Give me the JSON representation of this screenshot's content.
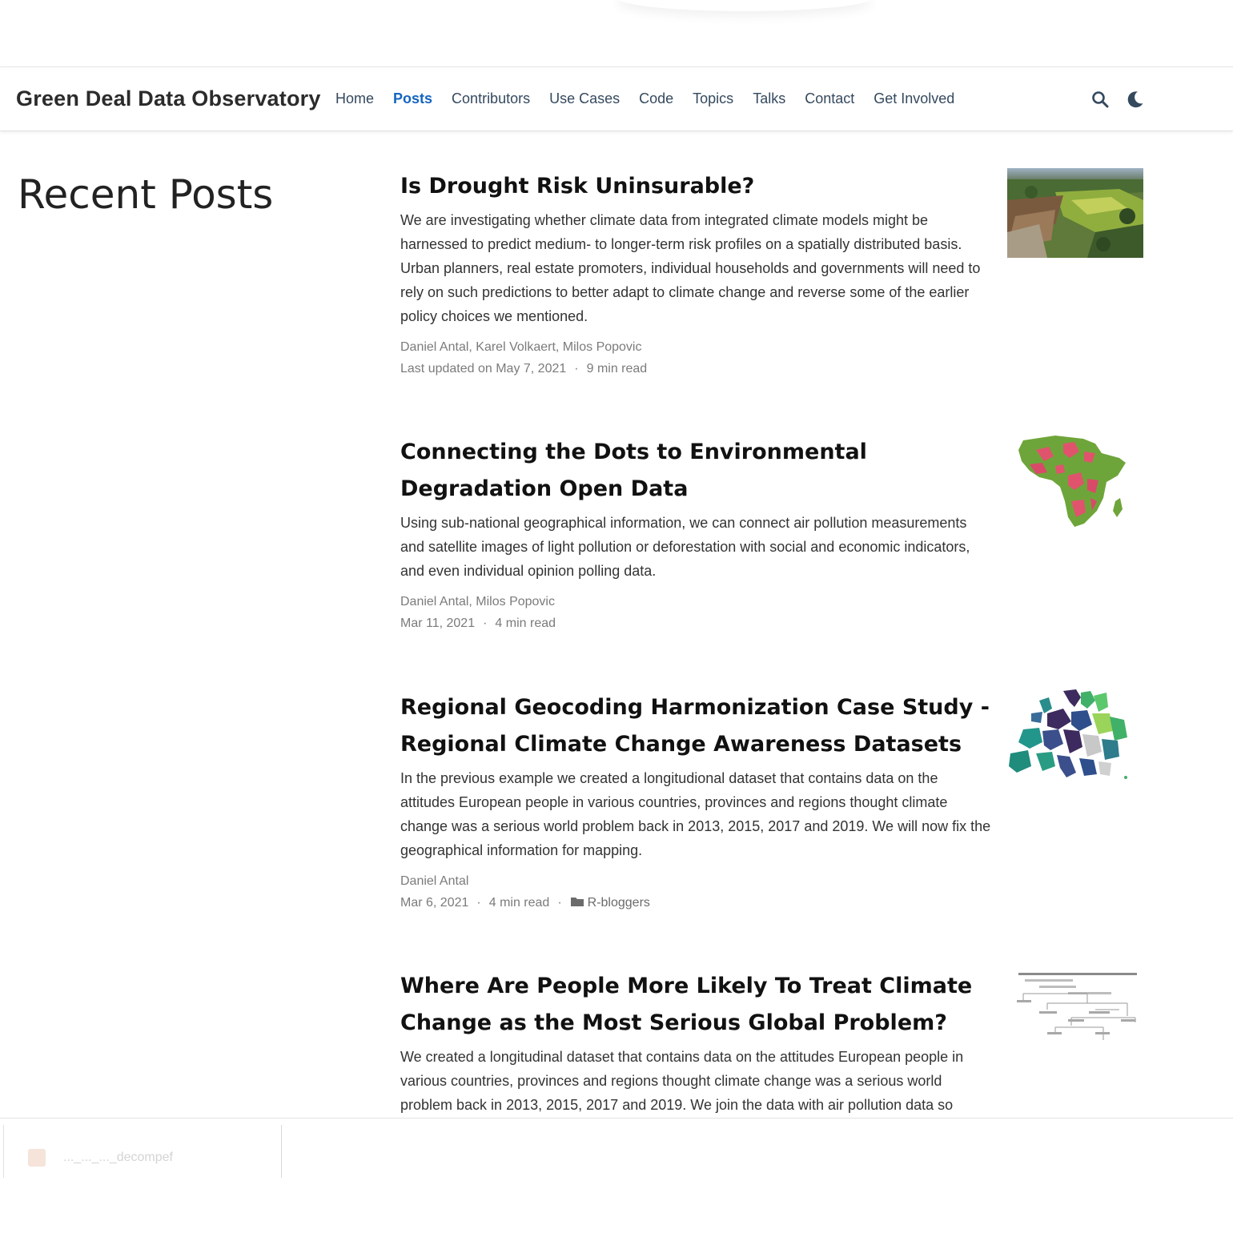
{
  "browser": {
    "bottom_tab_label": "..._..._..._decompef"
  },
  "navbar": {
    "brand": "Green Deal Data Observatory",
    "links": [
      {
        "label": "Home",
        "active": false
      },
      {
        "label": "Posts",
        "active": true
      },
      {
        "label": "Contributors",
        "active": false
      },
      {
        "label": "Use Cases",
        "active": false
      },
      {
        "label": "Code",
        "active": false
      },
      {
        "label": "Topics",
        "active": false
      },
      {
        "label": "Talks",
        "active": false
      },
      {
        "label": "Contact",
        "active": false
      },
      {
        "label": "Get Involved",
        "active": false
      }
    ],
    "icons": [
      "search-icon",
      "moon-icon"
    ],
    "accent_color": "#1565c0"
  },
  "page": {
    "heading": "Recent Posts"
  },
  "posts": [
    {
      "title": "Is Drought Risk Uninsurable?",
      "summary": "We are investigating whether climate data from integrated climate models might be harnessed to predict medium- to longer-term risk profiles on a spatially distributed basis. Urban planners, real estate promoters, individual households and governments will need to rely on such predictions to better adapt to climate change and reverse some of the earlier policy choices we mentioned.",
      "authors": "Daniel Antal, Karel Volkaert, Milos Popovic",
      "date": "Last updated on May 7, 2021",
      "read_time": "9 min read",
      "thumbnail": "aerial-landscape-photo"
    },
    {
      "title": "Connecting the Dots to Environmental Degradation Open Data",
      "summary": "Using sub-national geographical information, we can connect air pollution measurements and satellite images of light pollution or deforestation with social and economic indicators, and even individual opinion polling data.",
      "authors": "Daniel Antal, Milos Popovic",
      "date": "Mar 11, 2021",
      "read_time": "4 min read",
      "thumbnail": "africa-map"
    },
    {
      "title": "Regional Geocoding Harmonization Case Study - Regional Climate Change Awareness Datasets",
      "summary": "In the previous example we created a longitudional dataset that contains data on the attitudes European people in various countries, provinces and regions thought climate change was a serious world problem back in 2013, 2015, 2017 and 2019. We will now fix the geographical information for mapping.",
      "authors": "Daniel Antal",
      "date": "Mar 6, 2021",
      "read_time": "4 min read",
      "category": "R-bloggers",
      "thumbnail": "europe-map"
    },
    {
      "title": "Where Are People More Likely To Treat Climate Change as the Most Serious Global Problem?",
      "summary": "We created a longitudinal dataset that contains data on the attitudes European people in various countries, provinces and regions thought climate change was a serious world problem back in 2013, 2015, 2017 and 2019. We join the data with air pollution data so",
      "thumbnail": "classification-tree-chart"
    }
  ]
}
